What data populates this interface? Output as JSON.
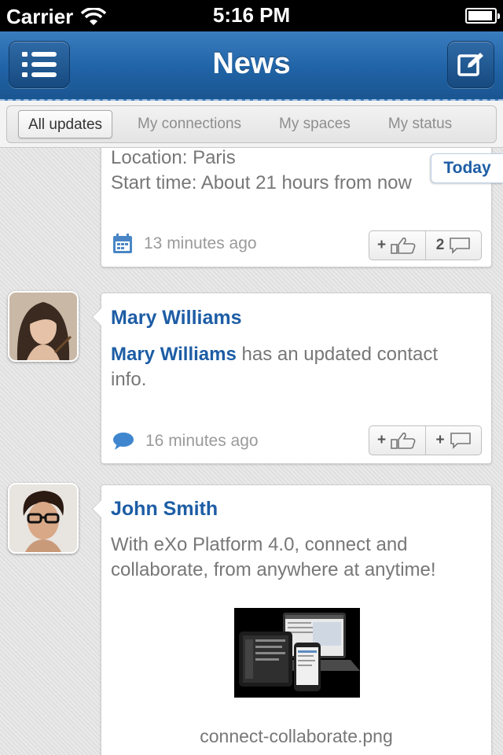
{
  "status_bar": {
    "carrier": "Carrier",
    "time": "5:16 PM",
    "battery_level": 0.95
  },
  "nav": {
    "title": "News",
    "left_icon": "menu-list-icon",
    "right_icon": "compose-icon"
  },
  "filters": {
    "items": [
      "All updates",
      "My connections",
      "My spaces",
      "My status"
    ],
    "selected": "All updates"
  },
  "section_badge": "Today",
  "feed": [
    {
      "type": "event",
      "lines": [
        "Location: Paris",
        "Start time: About 21 hours from now"
      ],
      "icon": "calendar-icon",
      "time_ago": "13 minutes ago",
      "like_label": "+",
      "comment_count": "2"
    },
    {
      "type": "contact_update",
      "author": "Mary Williams",
      "text_highlight": "Mary Williams",
      "text_rest": " has an updated contact info.",
      "icon": "comment-bubble-icon",
      "time_ago": "16 minutes ago",
      "like_label": "+",
      "comment_label": "+"
    },
    {
      "type": "post",
      "author": "John Smith",
      "text": "With eXo Platform 4.0, connect and collaborate, from anywhere at anytime!",
      "attachment": "connect-collaborate.png"
    }
  ],
  "colors": {
    "nav_blue": "#2063a6",
    "link_blue": "#1d5da5",
    "gray_text": "#777777"
  }
}
